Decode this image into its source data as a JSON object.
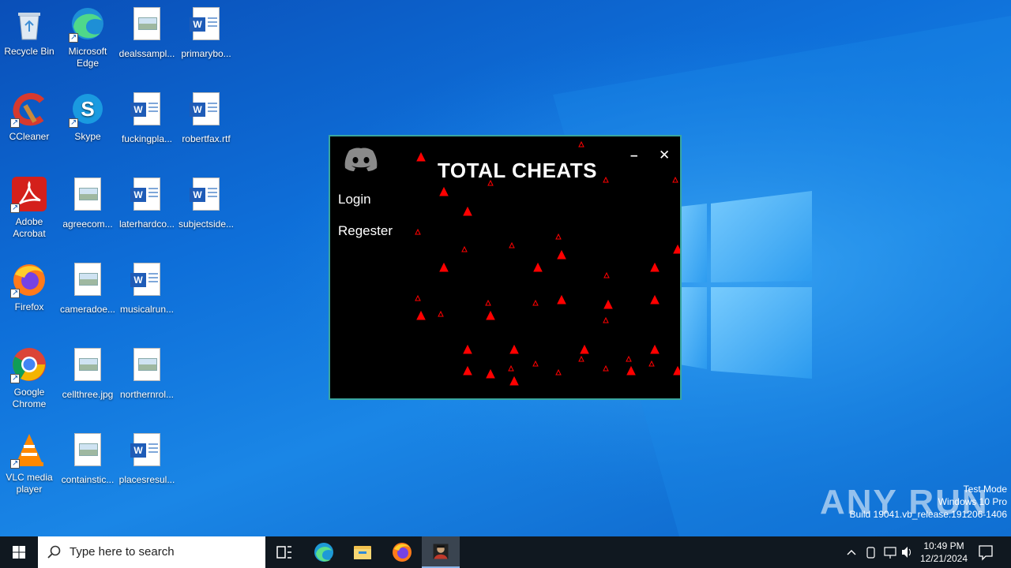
{
  "desktop": {
    "icons": [
      {
        "label": "Recycle Bin",
        "icon": "recycle-bin-icon"
      },
      {
        "label": "Microsoft Edge",
        "icon": "edge-icon"
      },
      {
        "label": "dealssampl...",
        "icon": "image-file-icon"
      },
      {
        "label": "primarybo...",
        "icon": "word-file-icon"
      },
      {
        "label": "CCleaner",
        "icon": "ccleaner-icon"
      },
      {
        "label": "Skype",
        "icon": "skype-icon"
      },
      {
        "label": "fuckingpla...",
        "icon": "word-file-icon"
      },
      {
        "label": "robertfax.rtf",
        "icon": "word-file-icon"
      },
      {
        "label": "Adobe Acrobat",
        "icon": "acrobat-icon"
      },
      {
        "label": "agreecom...",
        "icon": "image-file-icon"
      },
      {
        "label": "laterhardco...",
        "icon": "word-file-icon"
      },
      {
        "label": "subjectside...",
        "icon": "word-file-icon"
      },
      {
        "label": "Firefox",
        "icon": "firefox-icon"
      },
      {
        "label": "cameradoe...",
        "icon": "image-file-icon"
      },
      {
        "label": "musicalrun...",
        "icon": "word-file-icon"
      },
      {
        "label": "Google Chrome",
        "icon": "chrome-icon"
      },
      {
        "label": "cellthree.jpg",
        "icon": "image-file-icon"
      },
      {
        "label": "northernrol...",
        "icon": "image-file-icon"
      },
      {
        "label": "VLC media player",
        "icon": "vlc-icon"
      },
      {
        "label": "containstic...",
        "icon": "image-file-icon"
      },
      {
        "label": "placesresul...",
        "icon": "word-file-icon"
      }
    ]
  },
  "app": {
    "title": "TOTAL CHEATS",
    "logo_icon": "discord-icon",
    "login_label": "Login",
    "register_label": "Regester",
    "minimize_label": "–",
    "close_label": "✕",
    "accent_color": "#ff0000",
    "border_color": "#3aa6a0"
  },
  "watermark": {
    "brand": "ANY RUN",
    "line1": "Test Mode",
    "line2": "Windows 10 Pro",
    "line3": "Build 19041.vb_release.191206-1406"
  },
  "taskbar": {
    "search_placeholder": "Type here to search",
    "items": [
      "task-view-icon",
      "edge-icon",
      "file-explorer-icon",
      "firefox-icon",
      "total-cheats-app-icon"
    ],
    "time": "10:49 PM",
    "date": "12/21/2024"
  }
}
